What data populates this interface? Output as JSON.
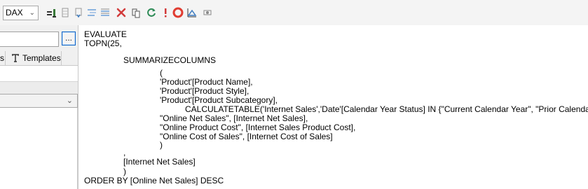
{
  "toolbar": {
    "language_value": "DAX",
    "icons": [
      "run-query-icon",
      "output-grid-icon",
      "output-file-icon",
      "format-query-icon",
      "format-small-icon",
      "clear-icon",
      "paste-icon",
      "refresh-icon",
      "error-icon",
      "stop-icon",
      "chart-icon",
      "server-icon"
    ]
  },
  "left_panel": {
    "browse_label": "...",
    "tab_partial_label": "s",
    "tab_templates_label": "Templates"
  },
  "editor": {
    "lines": [
      "EVALUATE",
      "TOPN(25,",
      "SUMMARIZECOLUMNS",
      "(",
      "'Product'[Product Name],",
      "'Product'[Product Style],",
      "'Product'[Product Subcategory],",
      "CALCULATETABLE('Internet Sales','Date'[Calendar Year Status] IN {\"Current Calendar Year\", \"Prior Calendar Year\"}),",
      "\"Online Net Sales\", [Internet Net Sales],",
      "\"Online Product Cost\", [Internet Sales Product Cost],",
      "\"Online Cost of Sales\", [Internet Cost of Sales]",
      ")",
      ",",
      "[Internet Net Sales]",
      ")",
      "ORDER BY [Online Net Sales] DESC"
    ]
  },
  "colors": {
    "stop_red": "#e03c31",
    "accent_blue": "#0a64c8"
  }
}
